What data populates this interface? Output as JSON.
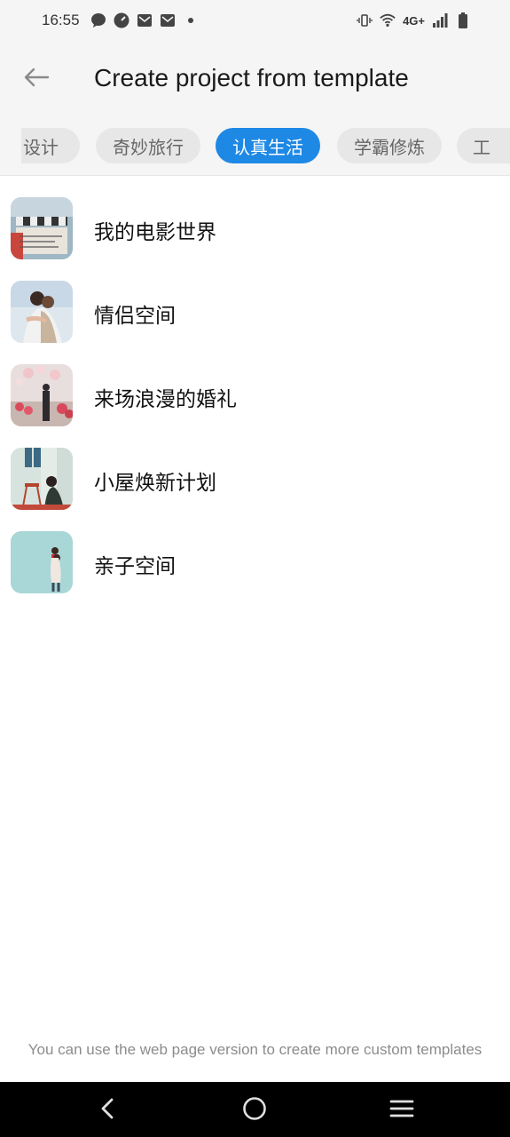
{
  "status_bar": {
    "time": "16:55",
    "network": "4G+",
    "left_icons": [
      "chat-bubble-icon",
      "speedometer-icon",
      "mail-icon",
      "mail-icon",
      "dot-icon"
    ],
    "right_icons": [
      "vibrate-icon",
      "wifi-icon",
      "signal-icon",
      "battery-icon"
    ]
  },
  "header": {
    "title": "Create project from template",
    "back_icon": "arrow-left-icon"
  },
  "tabs": [
    {
      "label": "设计",
      "active": false
    },
    {
      "label": "奇妙旅行",
      "active": false
    },
    {
      "label": "认真生活",
      "active": true
    },
    {
      "label": "学霸修炼",
      "active": false
    },
    {
      "label": "工",
      "active": false
    }
  ],
  "templates": [
    {
      "label": "我的电影世界"
    },
    {
      "label": "情侣空间"
    },
    {
      "label": "来场浪漫的婚礼"
    },
    {
      "label": "小屋焕新计划"
    },
    {
      "label": "亲子空间"
    }
  ],
  "footer": {
    "hint": "You can use the web page version to create more custom templates"
  },
  "colors": {
    "accent": "#1e88e5",
    "header_bg": "#f5f5f5",
    "tab_bg": "#e7e7e7",
    "nav_bg": "#000000"
  },
  "nav_bar": {
    "icons": [
      "back-chevron-icon",
      "home-circle-icon",
      "menu-lines-icon"
    ]
  }
}
